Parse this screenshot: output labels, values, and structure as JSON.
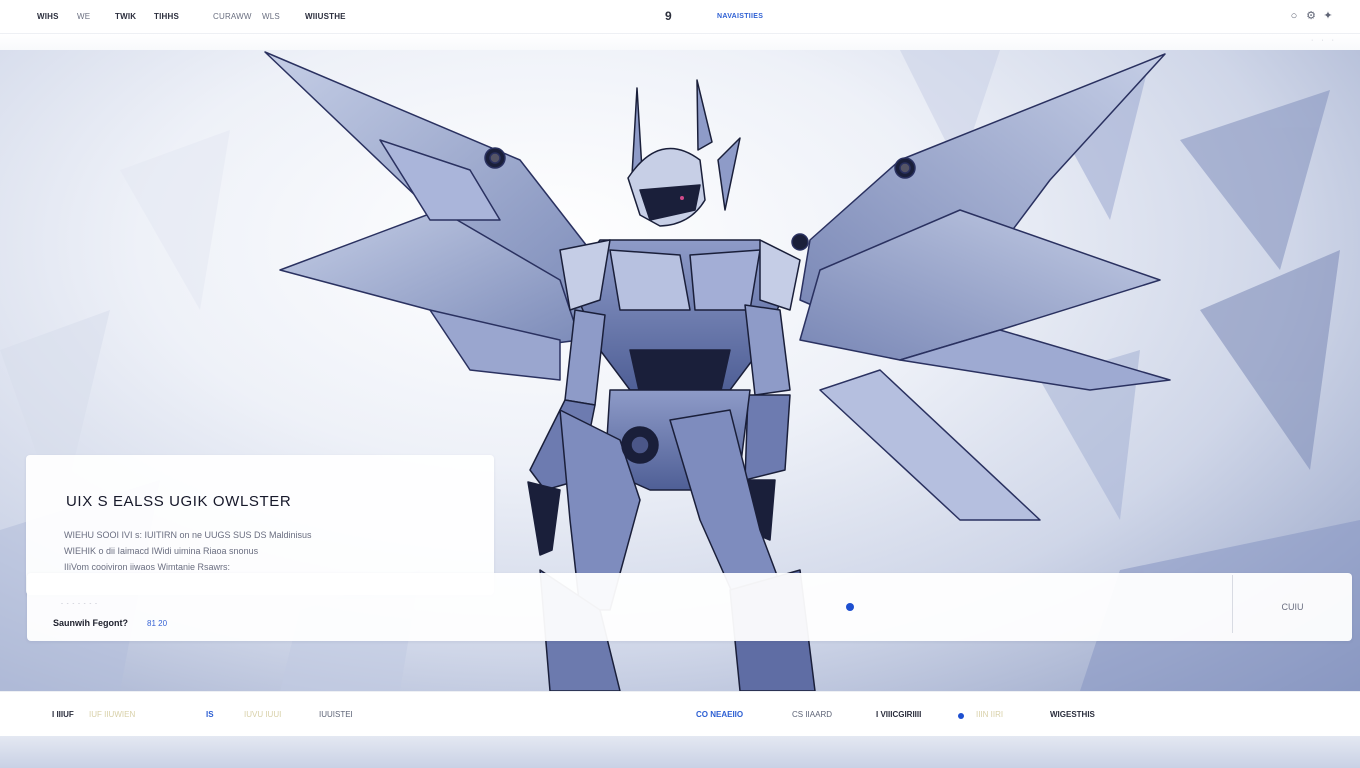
{
  "topbar": {
    "nav": [
      "WIHS",
      "WE",
      "TWIK",
      "TIHHS",
      "CURAWW",
      "WLS",
      "WIIUSTHE"
    ],
    "center_glyph": "9",
    "center_link": "NAVAISTIIES",
    "icons": [
      "circle-icon",
      "gear-icon",
      "sparkle-icon"
    ]
  },
  "hero": {
    "title": "UIX S EALSS UGIK OWLSTER",
    "lines": [
      "WIEHU SOOI IVI s: IUITIRN on ne UUGS SUS DS Maldinisus",
      "WIEHIK o dii Iaimacd IWidi uimina Riaoa snonus",
      "IIiVom cooiviron iiwaos Wimtanie Rsawrs:"
    ]
  },
  "control_bar": {
    "dashes": "- - - - - - -",
    "label": "Saunwih Fegont?",
    "meta": "81 20",
    "button": "CUIU"
  },
  "bottom": {
    "items": [
      {
        "text": "I IIIUF",
        "style": "dark"
      },
      {
        "text": "IUF IIUWIEN",
        "style": "pale"
      },
      {
        "text": "IS",
        "style": "blue"
      },
      {
        "text": "IUVU IUUI",
        "style": "pale"
      },
      {
        "text": "IUUISTEI",
        "style": "mid"
      },
      {
        "text": "CO  NEAEIIO",
        "style": "blue"
      },
      {
        "text": "CS IIAARD",
        "style": "mid"
      },
      {
        "text": "I  VIIICGIRIIII",
        "style": "dark"
      },
      {
        "text": "IIIN IIRI",
        "style": "pale"
      },
      {
        "text": "WIGESTHIS",
        "style": "dark"
      }
    ]
  },
  "colors": {
    "accent": "#1e4fd0",
    "mech": "#5d6ea8",
    "mech_dark": "#1a1f3a"
  }
}
